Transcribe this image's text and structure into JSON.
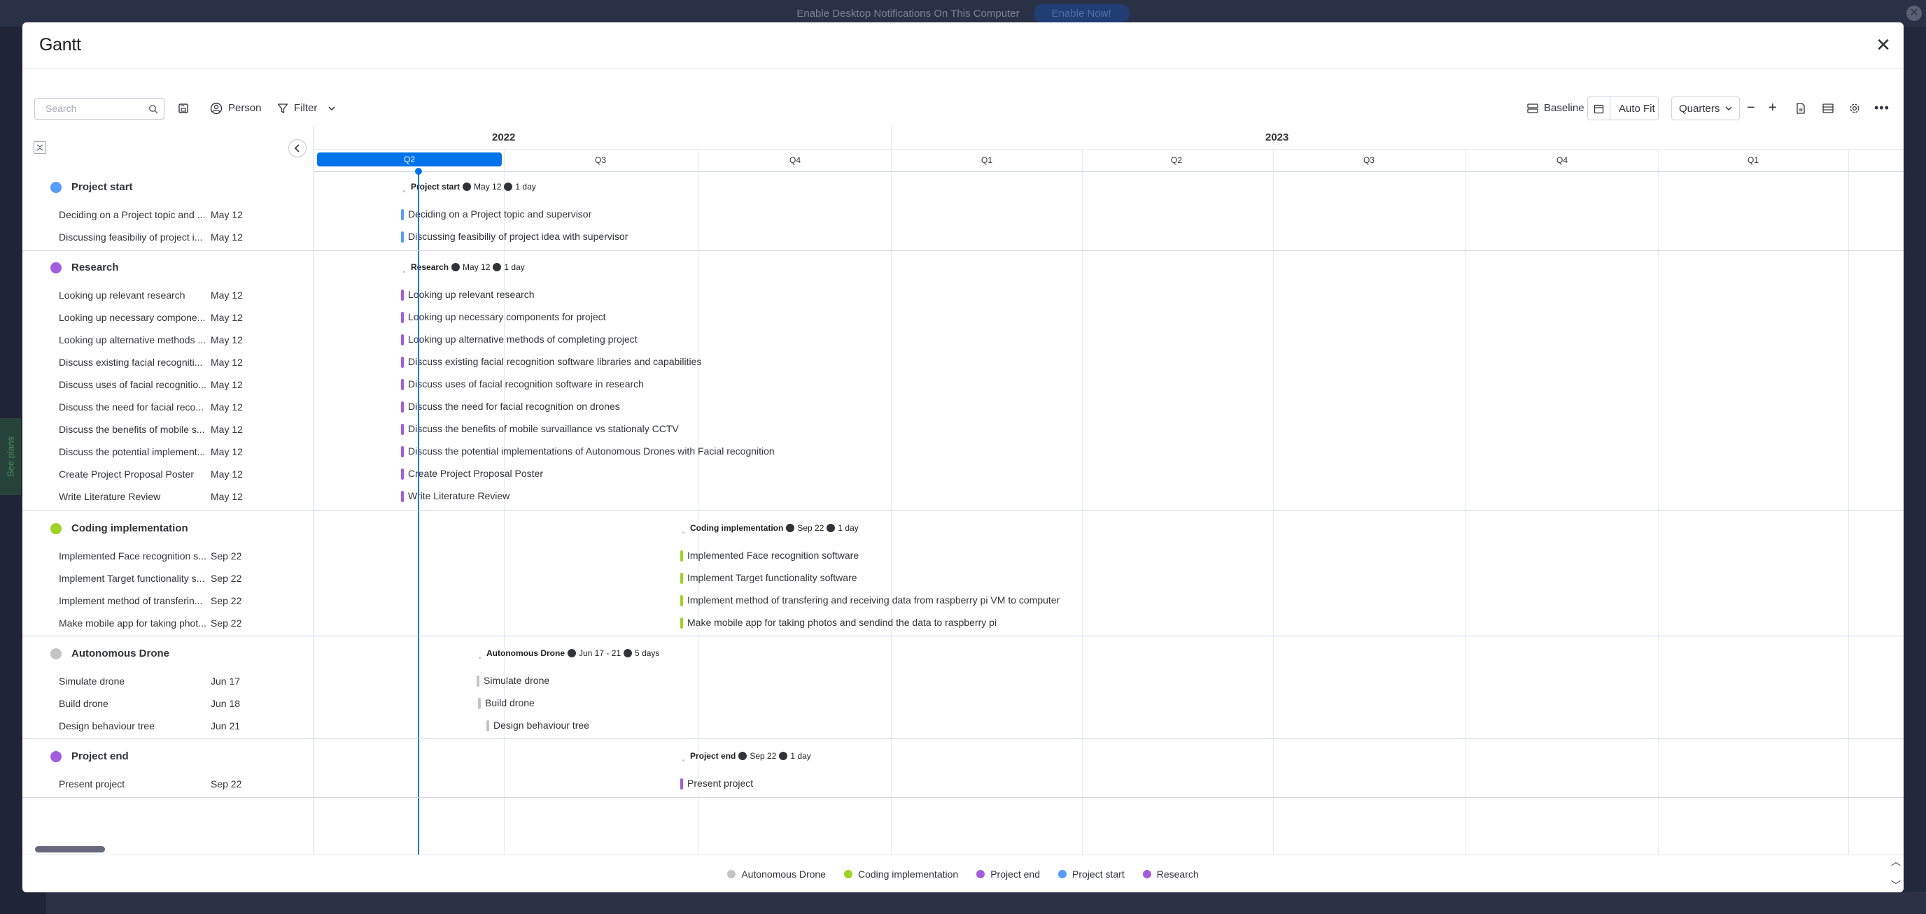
{
  "notification": {
    "text": "Enable Desktop Notifications On This Computer",
    "button": "Enable Now!"
  },
  "sidebar_promo": "See plans",
  "modal": {
    "title": "Gantt"
  },
  "toolbar": {
    "search_placeholder": "Search",
    "person": "Person",
    "filter": "Filter",
    "baseline": "Baseline",
    "auto_fit": "Auto Fit",
    "zoom_level": "Quarters"
  },
  "timeline": {
    "years": [
      "2022",
      "2023"
    ],
    "quarters": [
      "Q2",
      "Q3",
      "Q4",
      "Q1",
      "Q2",
      "Q3",
      "Q4",
      "Q1"
    ]
  },
  "groups": [
    {
      "name": "Project start",
      "color": "#579bfc",
      "summary": {
        "name": "Project start",
        "date": "May 12",
        "duration": "1 day"
      },
      "items": [
        {
          "name": "Deciding on a Project topic and supervisor",
          "short": "Deciding on a Project topic and ...",
          "date": "May 12"
        },
        {
          "name": "Discussing feasibiliy of project idea with supervisor",
          "short": "Discussing feasibiliy of project i...",
          "date": "May 12"
        }
      ]
    },
    {
      "name": "Research",
      "color": "#a25ddc",
      "summary": {
        "name": "Research",
        "date": "May 12",
        "duration": "1 day"
      },
      "items": [
        {
          "name": "Looking up relevant research",
          "short": "Looking up relevant research",
          "date": "May 12"
        },
        {
          "name": "Looking up necessary components for project",
          "short": "Looking up necessary compone...",
          "date": "May 12"
        },
        {
          "name": "Looking up alternative methods of completing project",
          "short": "Looking up alternative methods ...",
          "date": "May 12"
        },
        {
          "name": "Discuss existing facial recognition software libraries and capabilities",
          "short": "Discuss existing facial recogniti...",
          "date": "May 12"
        },
        {
          "name": "Discuss uses of facial recognition software in research",
          "short": "Discuss uses of facial recognitio...",
          "date": "May 12"
        },
        {
          "name": "Discuss the need for facial recognition on drones",
          "short": "Discuss the need for facial reco...",
          "date": "May 12"
        },
        {
          "name": "Discuss the benefits of mobile survaillance vs stationaly CCTV",
          "short": "Discuss the benefits of mobile s...",
          "date": "May 12"
        },
        {
          "name": "Discuss the potential implementations of Autonomous Drones with Facial recognition",
          "short": "Discuss the potential implement...",
          "date": "May 12"
        },
        {
          "name": "Create Project Proposal Poster",
          "short": "Create Project Proposal Poster",
          "date": "May 12"
        },
        {
          "name": "Write Literature Review",
          "short": "Write Literature Review",
          "date": "May 12"
        }
      ]
    },
    {
      "name": "Coding implementation",
      "color": "#9cd326",
      "summary": {
        "name": "Coding implementation",
        "date": "Sep 22",
        "duration": "1 day"
      },
      "items": [
        {
          "name": "Implemented Face recognition software",
          "short": "Implemented Face recognition s...",
          "date": "Sep 22"
        },
        {
          "name": "Implement Target functionality software",
          "short": "Implement Target functionality s...",
          "date": "Sep 22"
        },
        {
          "name": "Implement method of transfering and receiving data from raspberry pi VM to computer",
          "short": "Implement method of transferin...",
          "date": "Sep 22"
        },
        {
          "name": "Make mobile app for taking photos and sendind the data to raspberry pi",
          "short": "Make mobile app for taking phot...",
          "date": "Sep 22"
        }
      ]
    },
    {
      "name": "Autonomous Drone",
      "color": "#c4c4c4",
      "summary": {
        "name": "Autonomous Drone",
        "date": "Jun 17 - 21",
        "duration": "5 days"
      },
      "items": [
        {
          "name": "Simulate drone",
          "short": "Simulate drone",
          "date": "Jun 17"
        },
        {
          "name": "Build drone",
          "short": "Build drone",
          "date": "Jun 18"
        },
        {
          "name": "Design behaviour tree",
          "short": "Design behaviour tree",
          "date": "Jun 21"
        }
      ]
    },
    {
      "name": "Project end",
      "color": "#a25ddc",
      "summary": {
        "name": "Project end",
        "date": "Sep 22",
        "duration": "1 day"
      },
      "items": [
        {
          "name": "Present project",
          "short": "Present project",
          "date": "Sep 22"
        }
      ]
    }
  ],
  "legend": [
    {
      "label": "Autonomous Drone",
      "color": "#c4c4c4"
    },
    {
      "label": "Coding implementation",
      "color": "#9cd326"
    },
    {
      "label": "Project end",
      "color": "#a25ddc"
    },
    {
      "label": "Project start",
      "color": "#579bfc"
    },
    {
      "label": "Research",
      "color": "#a25ddc"
    }
  ]
}
